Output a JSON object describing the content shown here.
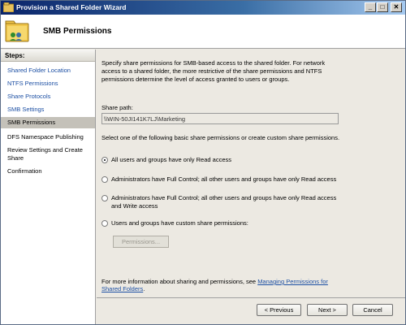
{
  "window": {
    "title": "Provision a Shared Folder Wizard"
  },
  "titlebar_buttons": {
    "minimize": "_",
    "maximize": "□",
    "close": "✕"
  },
  "header": {
    "title": "SMB Permissions",
    "icon": "shared-folder-icon"
  },
  "steps": {
    "heading": "Steps:",
    "items": [
      {
        "label": "Shared Folder Location",
        "state": "link"
      },
      {
        "label": "NTFS Permissions",
        "state": "link"
      },
      {
        "label": "Share Protocols",
        "state": "link"
      },
      {
        "label": "SMB Settings",
        "state": "link"
      },
      {
        "label": "SMB Permissions",
        "state": "current"
      },
      {
        "label": "DFS Namespace Publishing",
        "state": "plain"
      },
      {
        "label": "Review Settings and Create Share",
        "state": "plain"
      },
      {
        "label": "Confirmation",
        "state": "plain"
      }
    ]
  },
  "main": {
    "description": "Specify share permissions for SMB-based access to the shared folder. For network access to a shared folder, the more restrictive of the share permissions and NTFS permissions determine the level of access granted to users or groups.",
    "share_path_label": "Share path:",
    "share_path_value": "\\\\WIN-50JI141K7LJ\\Marketing",
    "instructions": "Select one of the following basic share permissions or create custom share permissions.",
    "options": [
      {
        "label": "All users and groups have only Read access",
        "checked": true
      },
      {
        "label": "Administrators have Full Control; all other users and groups have only Read access",
        "checked": false
      },
      {
        "label": "Administrators have Full Control; all other users and groups have only Read access and Write access",
        "checked": false
      },
      {
        "label": "Users and groups have custom share permissions:",
        "checked": false
      }
    ],
    "permissions_button": "Permissions...",
    "info_text": "For more information about sharing and permissions, see ",
    "info_link": "Managing Permissions for Shared Folders",
    "info_end": "."
  },
  "footer": {
    "previous": "< Previous",
    "next": "Next >",
    "cancel": "Cancel"
  }
}
